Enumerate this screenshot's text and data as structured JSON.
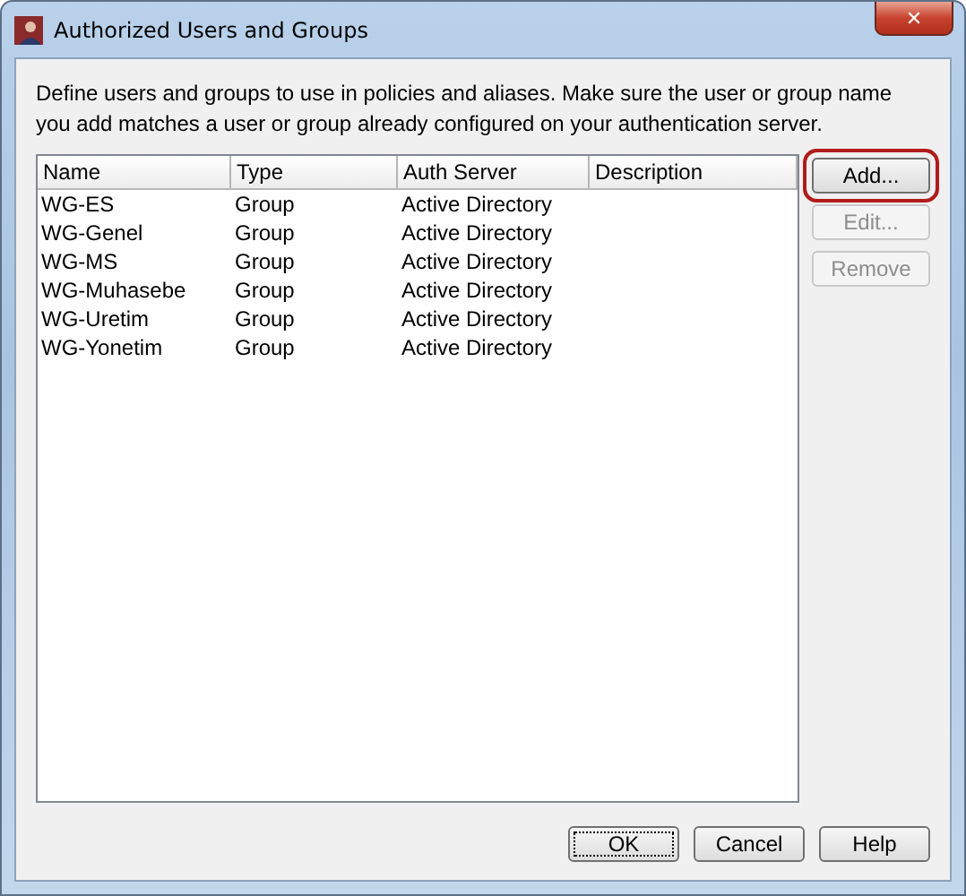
{
  "window": {
    "title": "Authorized Users and Groups",
    "close": "✕"
  },
  "description": "Define users and groups to use in policies and aliases. Make sure the user or group name you add matches a user or group already configured on your authentication server.",
  "table": {
    "columns": [
      "Name",
      "Type",
      "Auth Server",
      "Description"
    ],
    "rows": [
      [
        "WG-ES",
        "Group",
        "Active Directory",
        ""
      ],
      [
        "WG-Genel",
        "Group",
        "Active Directory",
        ""
      ],
      [
        "WG-MS",
        "Group",
        "Active Directory",
        ""
      ],
      [
        "WG-Muhasebe",
        "Group",
        "Active Directory",
        ""
      ],
      [
        "WG-Uretim",
        "Group",
        "Active Directory",
        ""
      ],
      [
        "WG-Yonetim",
        "Group",
        "Active Directory",
        ""
      ]
    ]
  },
  "side_buttons": [
    {
      "label": "Add...",
      "disabled": false,
      "highlighted": true
    },
    {
      "label": "Edit...",
      "disabled": true,
      "highlighted": false
    },
    {
      "label": "Remove",
      "disabled": true,
      "highlighted": false
    }
  ],
  "footer_buttons": [
    {
      "label": "OK",
      "focused": true
    },
    {
      "label": "Cancel",
      "focused": false
    },
    {
      "label": "Help",
      "focused": false
    }
  ]
}
